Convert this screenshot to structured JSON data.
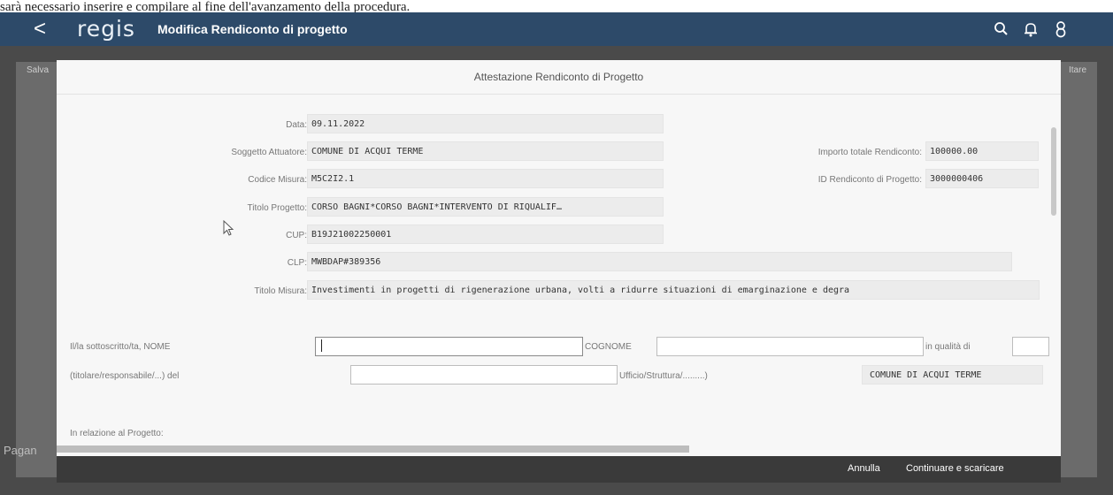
{
  "top_caption": "sarà necessario inserire e compilare al fine dell'avanzamento della procedura.",
  "shell": {
    "back_glyph": "<",
    "logo": "regis",
    "title": "Modifica Rendiconto di progetto",
    "icons": [
      "search-icon",
      "bell-icon",
      "user-icon"
    ]
  },
  "background": {
    "left_hint": "Salva",
    "right_hint": "Itare",
    "bottom_hint": "Pagan"
  },
  "dialog": {
    "title": "Attestazione Rendiconto di Progetto",
    "fields": {
      "data": {
        "label": "Data:",
        "value": "09.11.2022"
      },
      "soggetto": {
        "label": "Soggetto Attuatore:",
        "value": "COMUNE DI ACQUI TERME"
      },
      "codice": {
        "label": "Codice Misura:",
        "value": "M5C2I2.1"
      },
      "titolo_progetto": {
        "label": "Titolo Progetto:",
        "value": "CORSO BAGNI*CORSO BAGNI*INTERVENTO DI RIQUALIF…"
      },
      "cup": {
        "label": "CUP:",
        "value": "B19J21002250001"
      },
      "clp": {
        "label": "CLP:",
        "value": "MWBDAP#389356"
      },
      "titolo_misura": {
        "label": "Titolo Misura:",
        "value": "Investimenti in progetti di rigenerazione urbana, volti a ridurre situazioni di emarginazione e degra"
      },
      "importo": {
        "label": "Importo totale Rendiconto:",
        "value": "100000.00"
      },
      "id_rendiconto": {
        "label": "ID Rendiconto di Progetto:",
        "value": "3000000406"
      }
    },
    "declaration": {
      "nome_label": "Il/la sottoscritto/ta, NOME",
      "nome_value": "",
      "cognome_label": "COGNOME",
      "cognome_value": "",
      "qualita_label": "in qualità di",
      "qualita_value": "",
      "titolare_label": "(titolare/responsabile/...) del",
      "titolare_value": "",
      "ufficio_label": "Ufficio/Struttura/.........)",
      "ufficio_value": "COMUNE DI ACQUI TERME",
      "relazione_label": "In relazione al Progetto:"
    }
  },
  "footer": {
    "annulla": "Annulla",
    "continuare": "Continuare e scaricare"
  }
}
